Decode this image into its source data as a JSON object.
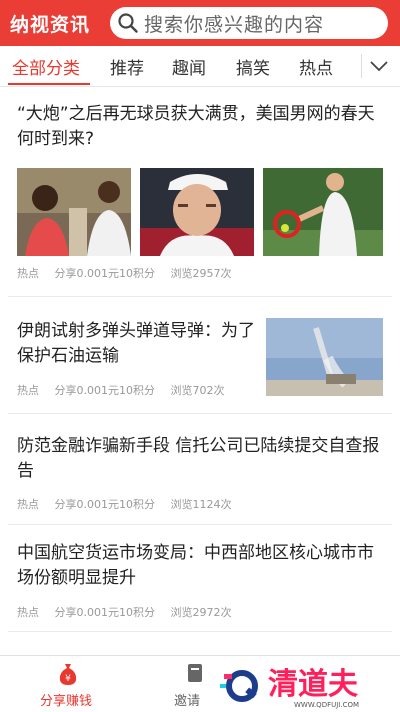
{
  "header": {
    "app_title": "纳视资讯",
    "search_placeholder": "搜索你感兴趣的内容"
  },
  "tabs": [
    {
      "label": "全部分类",
      "active": true
    },
    {
      "label": "推荐"
    },
    {
      "label": "趣闻"
    },
    {
      "label": "搞笑"
    },
    {
      "label": "热点"
    }
  ],
  "articles": [
    {
      "title": "“大炮”之后再无球员获大满贯，美国男网的春天何时到来?",
      "tag": "热点",
      "reward": "分享0.001元10积分",
      "views": "浏览2957次"
    },
    {
      "title": "伊朗试射多弹头弹道导弹：为了保护石油运输",
      "tag": "热点",
      "reward": "分享0.001元10积分",
      "views": "浏览702次"
    },
    {
      "title": "防范金融诈骗新手段 信托公司已陆续提交自查报告",
      "tag": "热点",
      "reward": "分享0.001元10积分",
      "views": "浏览1124次"
    },
    {
      "title": "中国航空货运市场变局：中西部地区核心城市市场份额明显提升",
      "tag": "热点",
      "reward": "分享0.001元10积分",
      "views": "浏览2972次"
    }
  ],
  "bottom_nav": [
    {
      "label": "分享赚钱",
      "active": true
    },
    {
      "label": "邀请"
    }
  ],
  "watermark": {
    "brand": "清道夫",
    "url": "WWW.QDFUJI.COM"
  },
  "colors": {
    "accent": "#ea3d36",
    "muted": "#999999"
  }
}
